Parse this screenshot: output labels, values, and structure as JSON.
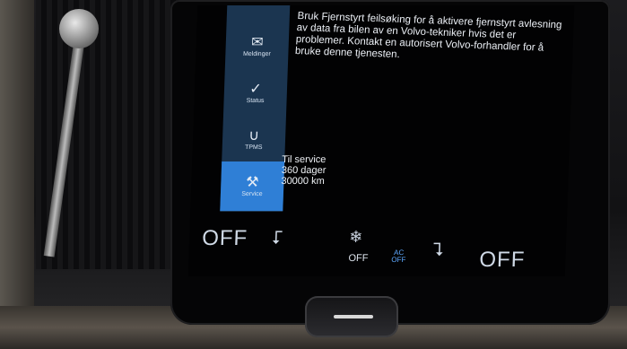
{
  "menu": {
    "items": [
      {
        "label": "Meldinger",
        "icon": "messages-icon",
        "glyph": "✉"
      },
      {
        "label": "Status",
        "icon": "status-icon",
        "glyph": "✓"
      },
      {
        "label": "TPMS",
        "icon": "tpms-icon",
        "glyph": "∪"
      },
      {
        "label": "Service",
        "icon": "service-icon",
        "glyph": "⚒"
      }
    ],
    "active": "Service"
  },
  "info": {
    "paragraph": "Bruk Fjernstyrt feilsøking for å aktivere fjernstyrt avlesning av data fra bilen av en Volvo-tekniker hvis det er problemer. Kontakt en autorisert Volvo-forhandler for å bruke denne tjenesten."
  },
  "service": {
    "line1": "Til service",
    "line2": "360 dager",
    "line3": "30000 km"
  },
  "climate": {
    "left_temp": "OFF",
    "right_temp": "OFF",
    "fan_status": "OFF",
    "ac_label": "AC",
    "ac_status": "OFF",
    "left_seat_glyph": "⮦",
    "right_seat_glyph": "⮧",
    "fan_glyph": "❄"
  },
  "colors": {
    "menu_bg": "#1b3550",
    "menu_active": "#2f7fd6",
    "ac_accent": "#5fa9ff"
  }
}
